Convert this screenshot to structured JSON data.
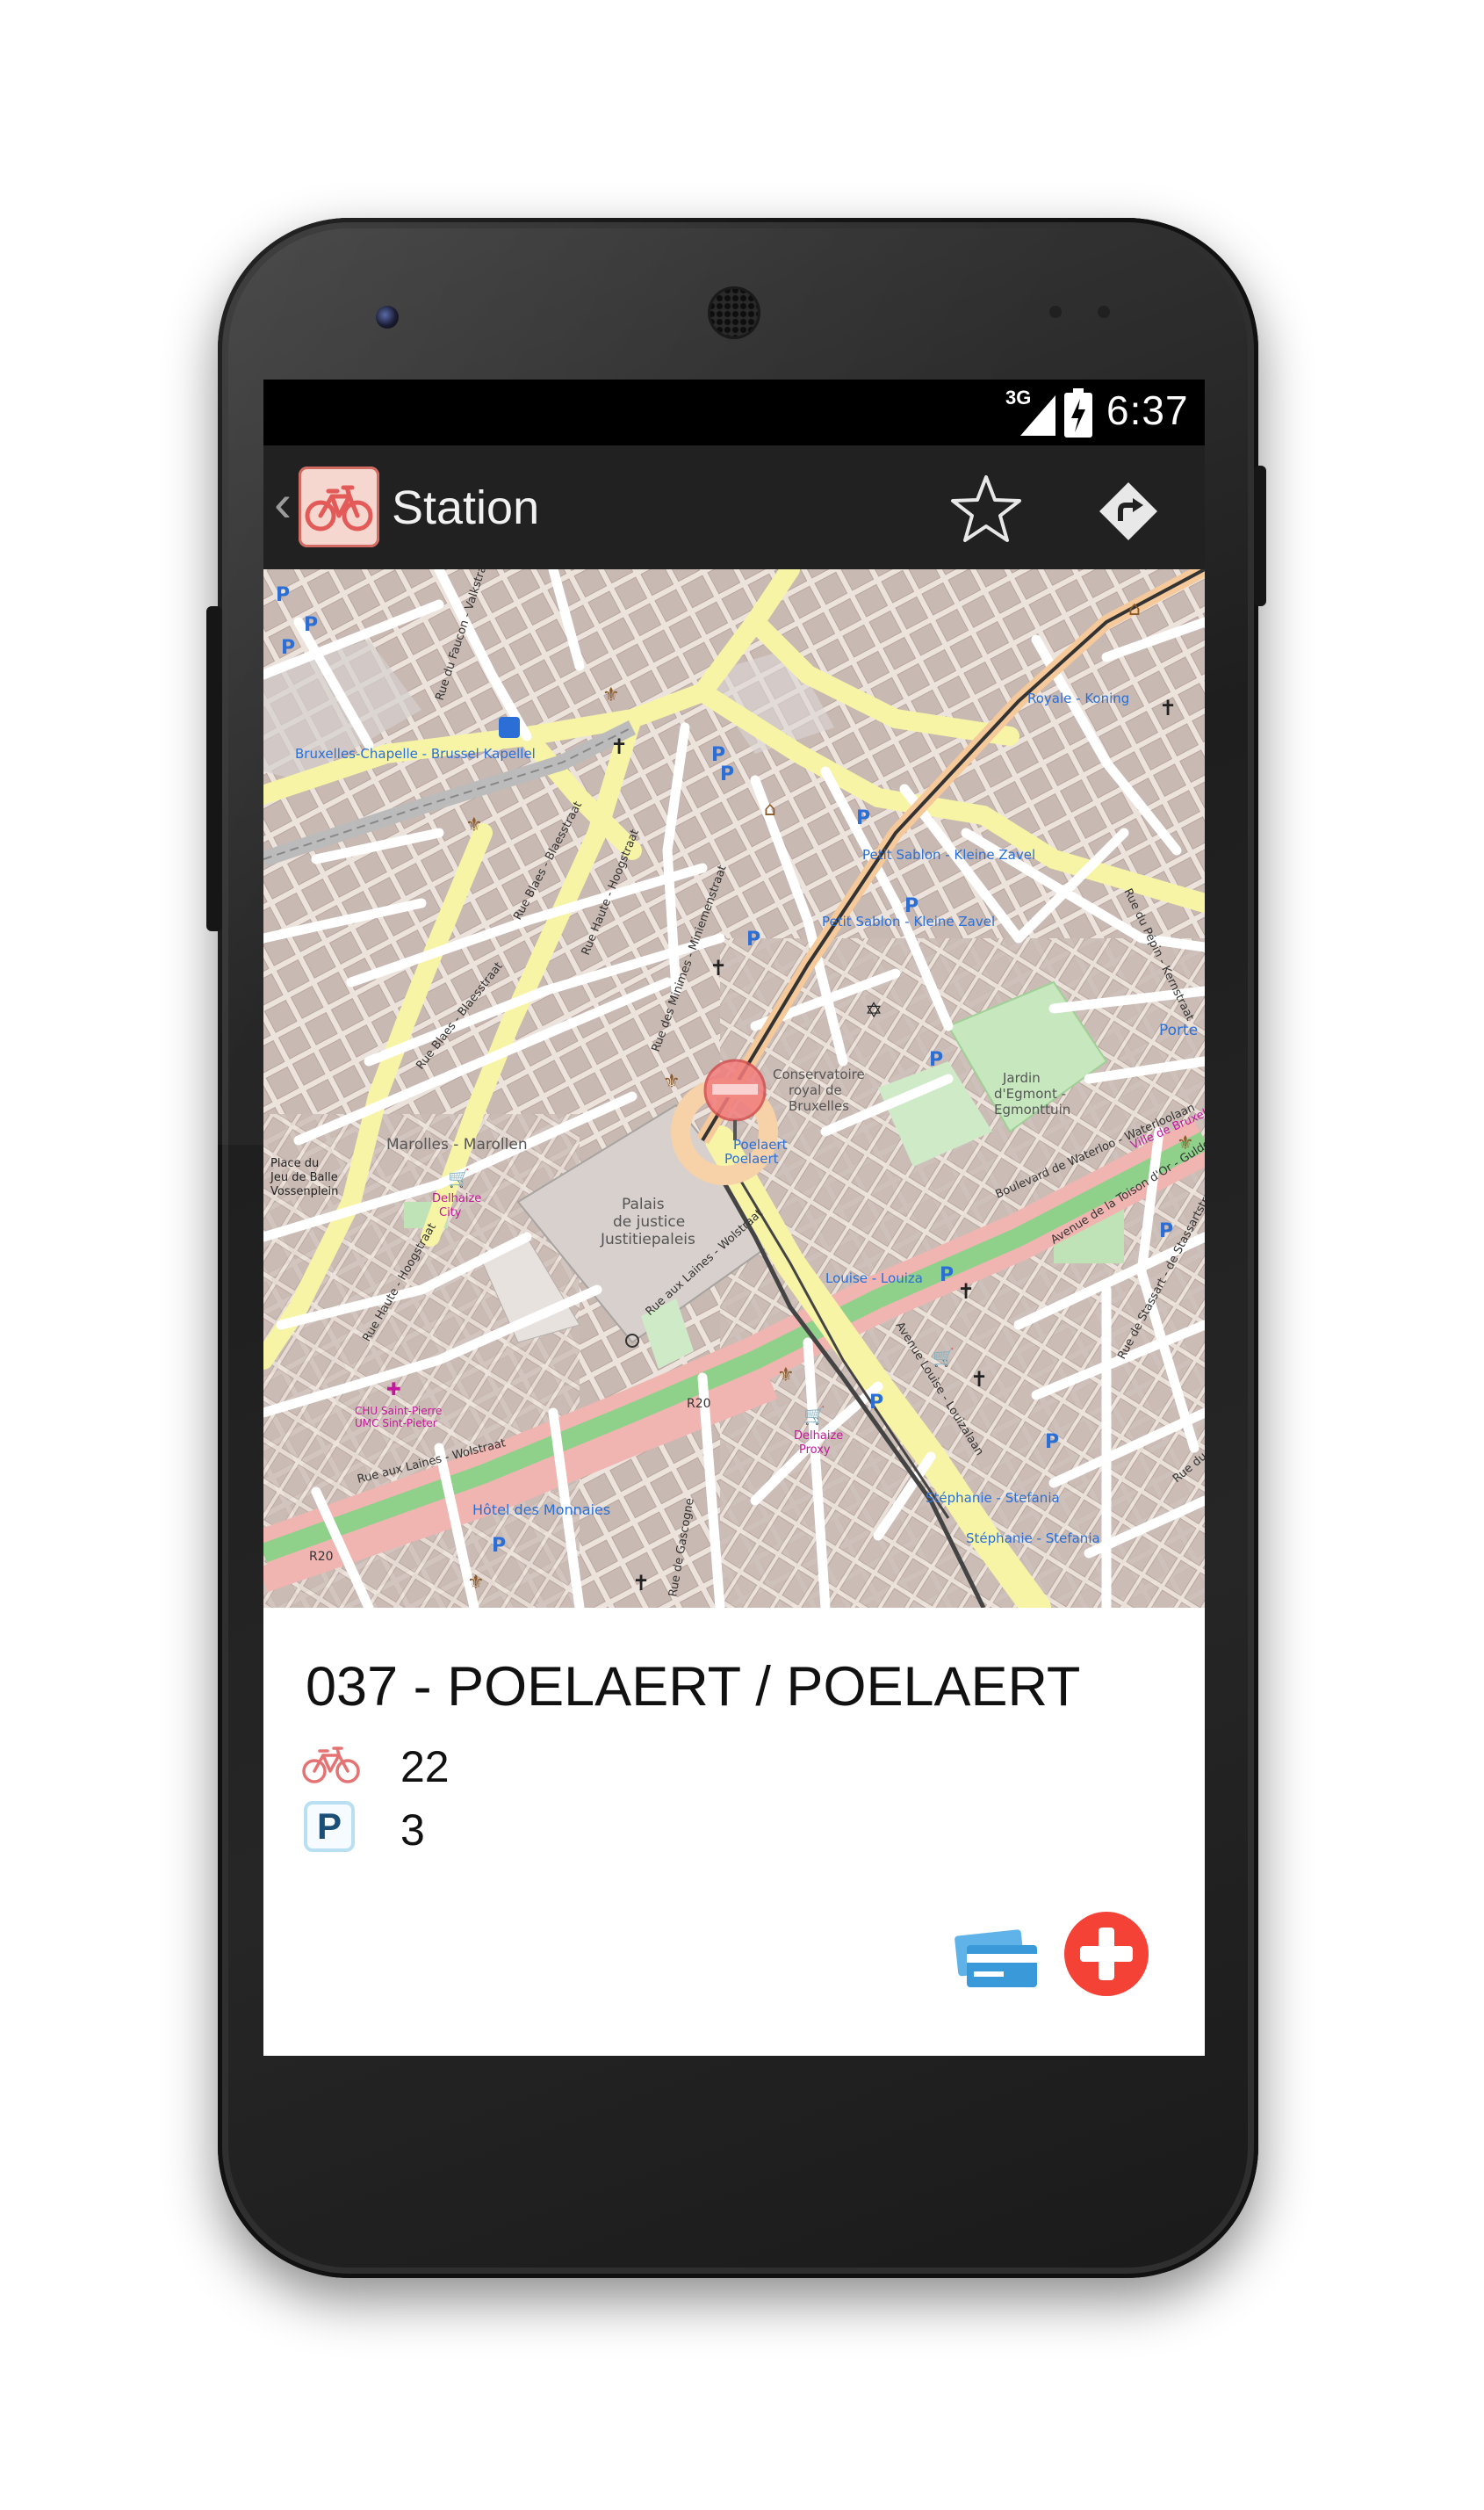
{
  "status_bar": {
    "network": "3G",
    "time": "6:37"
  },
  "action_bar": {
    "title": "Station",
    "icons": {
      "up": "chevron-left-icon",
      "app": "bicycle-icon",
      "favorite": "star-outline-icon",
      "directions": "directions-icon"
    }
  },
  "map": {
    "labels": {
      "bruxelles_chapelle": "Bruxelles-Chapelle - Brussel Kapellel",
      "royale": "Royale - Koning",
      "petit_sablon_1": "Petit Sablon - Kleine Zavel",
      "petit_sablon_2": "Petit Sablon - Kleine Zavel",
      "conservatoire": [
        "Conservatoire",
        "royal de",
        "Bruxelles"
      ],
      "jardin": [
        "Jardin",
        "d'Egmont -",
        "Egmonttuin"
      ],
      "poelaert": [
        "Poelaert",
        "Poelaert"
      ],
      "marolles": "Marolles - Marollen",
      "place_jeu_de_balle": [
        "Place du",
        "Jeu de Balle",
        "Vossenplein"
      ],
      "delhaize_city": [
        "Delhaize",
        "City"
      ],
      "palais": [
        "Palais",
        "de justice",
        "Justitiepaleis"
      ],
      "louise": "Louise - Louiza",
      "ville_bruxelles": "Ville de Bruxelles",
      "chu": [
        "CHU Saint-Pierre",
        "UMC Sint-Pieter"
      ],
      "r20_a": "R20",
      "r20_b": "R20",
      "delhaize_proxy": [
        "Delhaize",
        "Proxy"
      ],
      "hotel_monnaies": "Hôtel des Monnaies",
      "stephanie_1": "Stéphanie - Stefania",
      "stephanie_2": "Stéphanie - Stefania",
      "porte": "Porte",
      "rue_blaes": "Rue Blaes - Blaesstraat",
      "rue_blaes_2": "Rue Blaes - Blaesstraat",
      "rue_haute": "Rue Haute - Hoogstraat",
      "rue_haute_2": "Rue Haute - Hoogstraat",
      "rue_minimes": "Rue des Minimes - Miniemenstraat",
      "rue_aux_laines": "Rue aux Laines - Wolstraat",
      "rue_aux_laines_2": "Rue aux Laines - Wolstraat",
      "bd_waterloo": "Boulevard de Waterloo - Waterloolaan",
      "av_toison": "Avenue de la Toison d'Or - Guldenvlieslaan",
      "av_louise": "Avenue Louise - Louizalaan",
      "bd_stassart": "Rue de Stassart - de Stassartstraat",
      "rue_pepin": "Rue du Pépin - Kernstraat",
      "rue_prince": "Rue du Prince",
      "rue_faucon": "Rue du Faucon - Valkstraat",
      "rue_gascogne": "Rue de Gascogne"
    }
  },
  "station": {
    "name": "037 - POELAERT / POELAERT",
    "bikes_available": "22",
    "slots_available": "3",
    "parking_letter": "P"
  },
  "colors": {
    "accent_red": "#f44336",
    "bike_icon": "#e57373",
    "card_blue": "#3a9ad9",
    "action_bar": "#212121",
    "status_bar": "#000000"
  }
}
